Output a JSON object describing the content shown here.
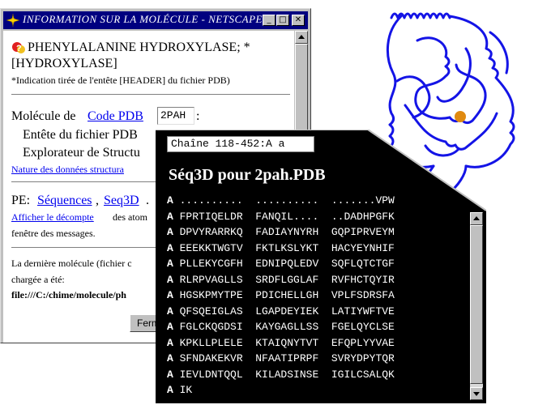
{
  "info_window": {
    "title": "INFORMATION SUR LA MOLÉCULE - NETSCAPE",
    "controls": {
      "minimize": "_",
      "maximize": "□",
      "close": "✕"
    },
    "heading": "PHENYLALANINE HYDROXYLASE; *",
    "heading_line2": "[HYDROXYLASE]",
    "header_note": "*Indication tirée de l'entête [HEADER] du fichier PDB)",
    "molecule_label": "Molécule de",
    "code_pdb_link": "Code PDB",
    "code_value": "2PAH",
    "code_suffix": ":",
    "entete_label": "Entête du fichier PDB",
    "explorateur_label": "Explorateur de Structu",
    "nature_link": "Nature des données structura",
    "pe_label": "PE:",
    "sequences_link": "Séquences",
    "comma": ",",
    "seq3d_link": "Seq3D",
    "period": ".",
    "afficher_link": "Afficher le décompte",
    "afficher_rest": " des atom",
    "afficher_line2": "fenêtre des messages.",
    "last_mol_line1": "La dernière molécule (fichier c",
    "last_mol_line2": "chargée a été:",
    "last_mol_path": "file:///C:/chime/molecule/ph",
    "close_button": "Ferm"
  },
  "seq_window": {
    "chain_selector": "Chaîne 118-452:A a",
    "title": "Séq3D pour 2pah.PDB",
    "lines": [
      {
        "chain": "A",
        "seq": " ..........  ..........  .......VPW"
      },
      {
        "chain": "A",
        "seq": " FPRTIQELDR  FANQIL....  ..DADHPGFK"
      },
      {
        "chain": "A",
        "seq": " DPVYRARRKQ  FADIAYNYRH  GQPIPRVEYM"
      },
      {
        "chain": "A",
        "seq": " EEEKKTWGTV  FKTLKSLYKT  HACYEYNHIF"
      },
      {
        "chain": "A",
        "seq": " PLLEKYCGFH  EDNIPQLEDV  SQFLQTCTGF"
      },
      {
        "chain": "A",
        "seq": " RLRPVAGLLS  SRDFLGGLAF  RVFHCTQYIR"
      },
      {
        "chain": "A",
        "seq": " HGSKPMYTPE  PDICHELLGH  VPLFSDRSFA"
      },
      {
        "chain": "A",
        "seq": " QFSQEIGLAS  LGAPDEYIEK  LATIYWFTVE"
      },
      {
        "chain": "A",
        "seq": " FGLCKQGDSI  KAYGAGLLSS  FGELQYCLSE"
      },
      {
        "chain": "A",
        "seq": " KPKLLPLELE  KTAIQNYTVT  EFQPLYYVAE"
      },
      {
        "chain": "A",
        "seq": " SFNDAKEKVR  NFAATIPRPF  SVRYDPYTQR"
      },
      {
        "chain": "A",
        "seq": " IEVLDNTQQL  KILADSINSE  IGILCSALQK"
      },
      {
        "chain": "A",
        "seq": " IK"
      }
    ]
  },
  "colors": {
    "titlebar": "#000080",
    "link": "#0000ee",
    "ribbon": "#1414e6",
    "ribbon_ion": "#e08a10"
  }
}
